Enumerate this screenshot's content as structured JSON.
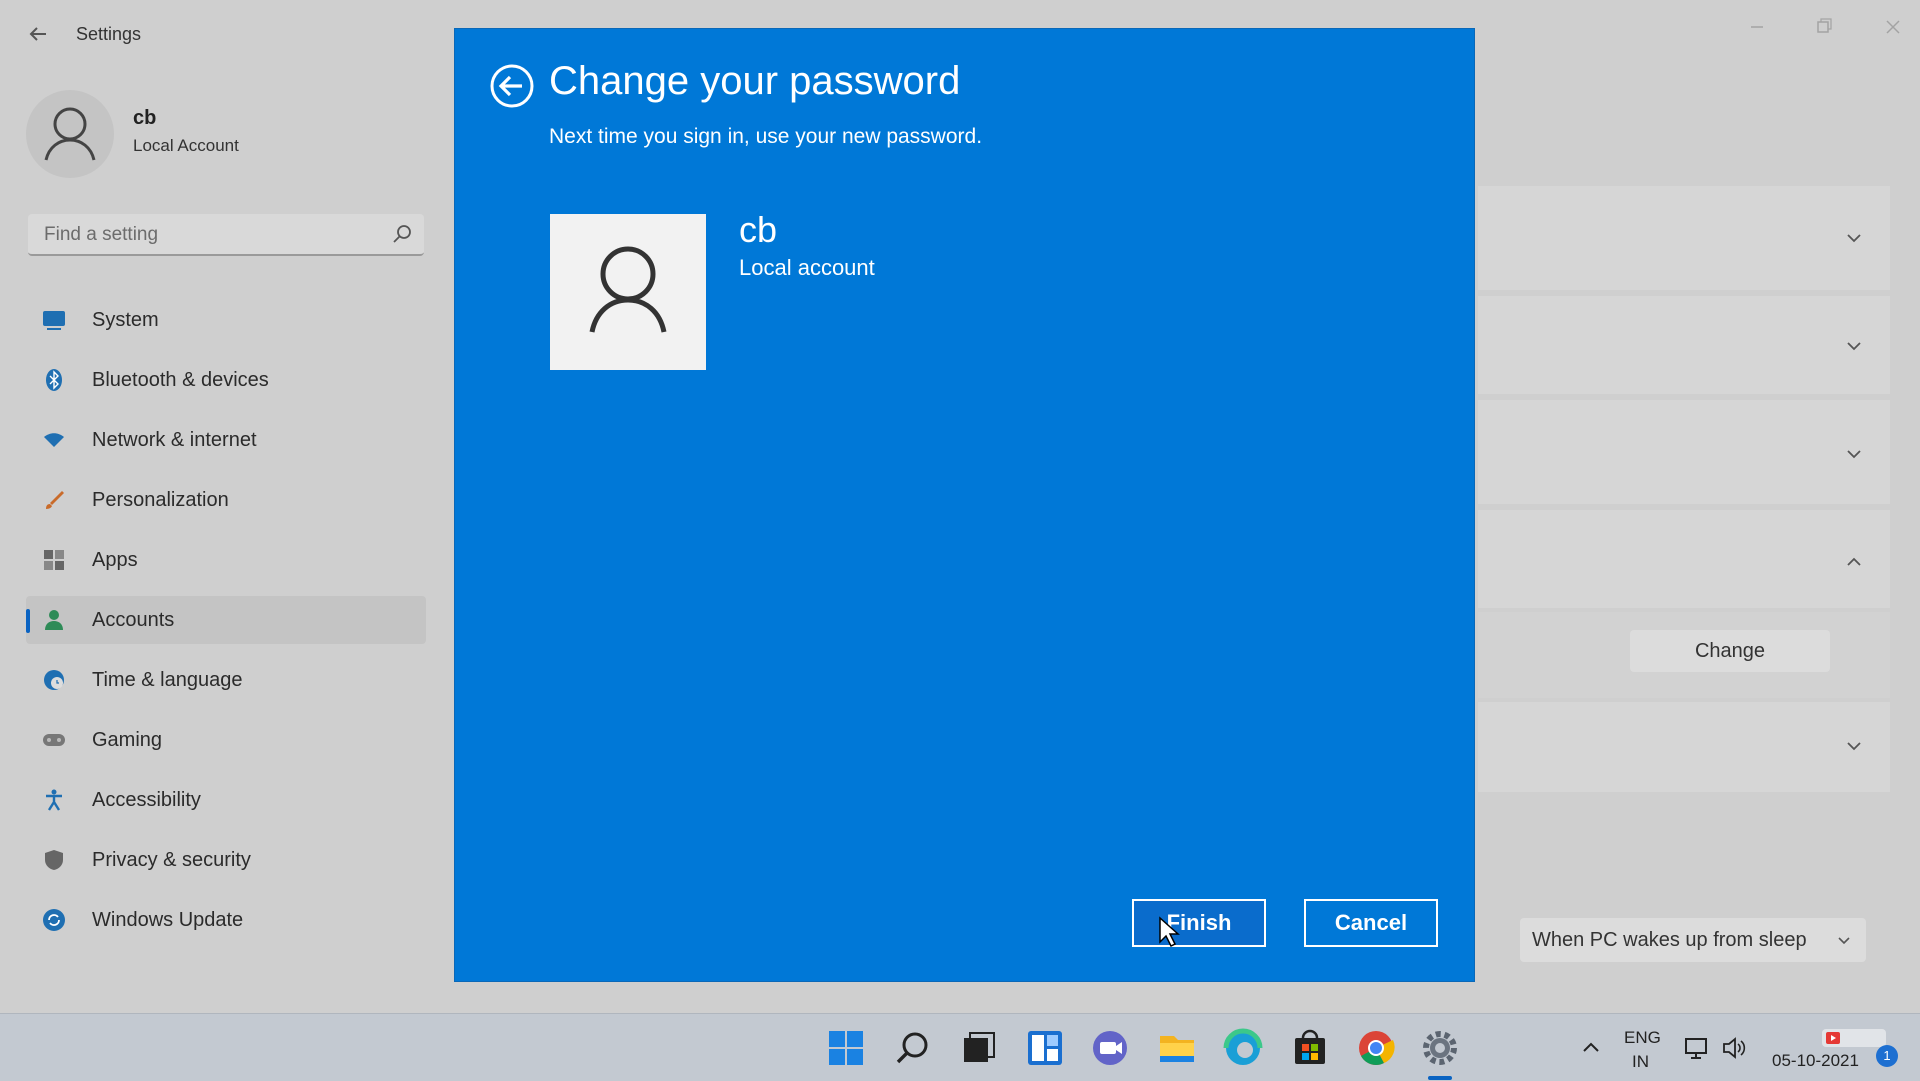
{
  "settings": {
    "app_title": "Settings",
    "profile": {
      "name": "cb",
      "type": "Local Account"
    },
    "search": {
      "placeholder": "Find a setting"
    },
    "nav": [
      {
        "label": "System",
        "icon": "monitor-icon",
        "color": "#1f6fb2"
      },
      {
        "label": "Bluetooth & devices",
        "icon": "bluetooth-icon",
        "color": "#1f6fb2"
      },
      {
        "label": "Network & internet",
        "icon": "wifi-icon",
        "color": "#1f6fb2"
      },
      {
        "label": "Personalization",
        "icon": "brush-icon",
        "color": "#c96b2a"
      },
      {
        "label": "Apps",
        "icon": "apps-icon",
        "color": "#555555"
      },
      {
        "label": "Accounts",
        "icon": "person-icon",
        "color": "#2e8b57",
        "selected": true
      },
      {
        "label": "Time & language",
        "icon": "globe-clock-icon",
        "color": "#1f6fb2"
      },
      {
        "label": "Gaming",
        "icon": "gamepad-icon",
        "color": "#777777"
      },
      {
        "label": "Accessibility",
        "icon": "accessibility-icon",
        "color": "#1f6fb2"
      },
      {
        "label": "Privacy & security",
        "icon": "shield-icon",
        "color": "#666666"
      },
      {
        "label": "Windows Update",
        "icon": "update-icon",
        "color": "#1f6fb2"
      }
    ],
    "change_button": "Change",
    "sleep_option": "When PC wakes up from sleep"
  },
  "dialog": {
    "title": "Change your password",
    "subtitle": "Next time you sign in, use your new password.",
    "user_name": "cb",
    "user_type": "Local account",
    "finish_label": "Finish",
    "cancel_label": "Cancel",
    "accent": "#0078d7"
  },
  "taskbar": {
    "lang_line1": "ENG",
    "lang_line2": "IN",
    "date": "05-10-2021",
    "notification_count": "1",
    "icons": [
      "start-icon",
      "search-icon",
      "task-view-icon",
      "widgets-icon",
      "chat-icon",
      "file-explorer-icon",
      "edge-icon",
      "store-icon",
      "chrome-icon",
      "settings-icon"
    ]
  }
}
